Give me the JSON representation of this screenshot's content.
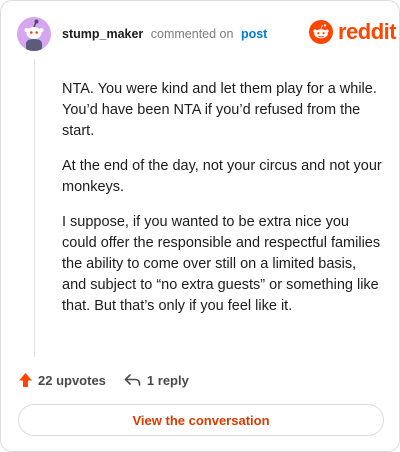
{
  "header": {
    "username": "stump_maker",
    "action": "commented on",
    "post_link": "post",
    "brand": "reddit"
  },
  "comment": {
    "paragraphs": [
      "NTA. You were kind and let them play for a while. You’d have been NTA if you’d refused from the start.",
      "At the end of the day, not your circus and not your monkeys.",
      "I suppose, if you wanted to be extra nice you could offer the responsible and respectful families the ability to come over still on a limited basis, and subject to “no extra guests” or something like that. But that’s only if you feel like it."
    ]
  },
  "footer": {
    "upvotes": "22 upvotes",
    "replies": "1 reply"
  },
  "cta": {
    "label": "View the conversation"
  },
  "colors": {
    "brand_orange": "#ff4500",
    "link_blue": "#0079d3",
    "cta_text": "#d93a00",
    "avatar_bg": "#d6a6f0"
  },
  "icons": {
    "avatar": "snoo-avatar",
    "logo": "reddit-alien-icon",
    "upvote": "upvote-arrow-icon",
    "reply": "reply-arrow-icon"
  }
}
